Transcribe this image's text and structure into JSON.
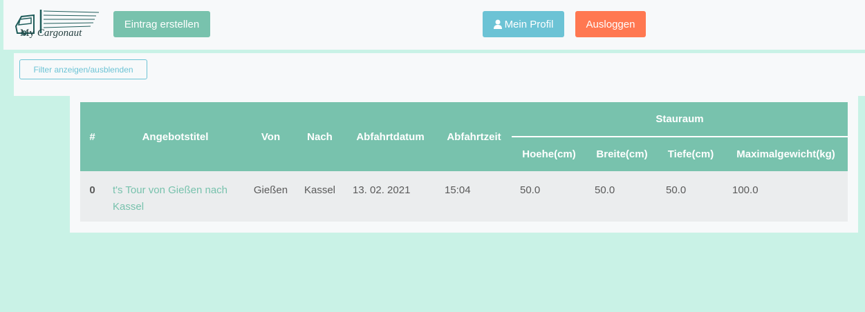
{
  "brand": {
    "logo_text_1": "My",
    "logo_text_2": "Cargonaut"
  },
  "navbar": {
    "create_label": "Eintrag erstellen",
    "profile_label": "Mein Profil",
    "logout_label": "Ausloggen"
  },
  "filter": {
    "toggle_label": "Filter anzeigen/ausblenden"
  },
  "table": {
    "headers": {
      "index": "#",
      "title": "Angebotstitel",
      "from": "Von",
      "to": "Nach",
      "date": "Abfahrtdatum",
      "time": "Abfahrtzeit",
      "group": "Stauraum",
      "height": "Hoehe(cm)",
      "width": "Breite(cm)",
      "depth": "Tiefe(cm)",
      "max_weight": "Maximalgewicht(kg)"
    },
    "rows": [
      {
        "index": "0",
        "title_line1": "t's Tour von Gießen nach",
        "title_line2": "Kassel",
        "from": "Gießen",
        "to": "Kassel",
        "date": "13. 02. 2021",
        "time": "15:04",
        "height": "50.0",
        "width": "50.0",
        "depth": "50.0",
        "max_weight": "100.0"
      }
    ]
  },
  "colors": {
    "background": "#c9f2e6",
    "primary": "#78c2ad",
    "info": "#6cc3d5",
    "danger": "#ff7851"
  },
  "icons": {
    "profile_icon": "user-icon",
    "logo_icon": "truck-icon"
  }
}
